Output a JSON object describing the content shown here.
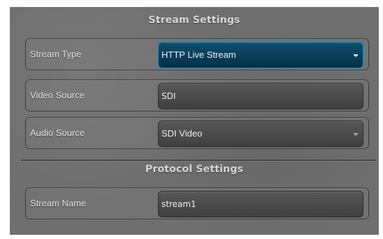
{
  "stream_settings": {
    "title": "Stream Settings",
    "stream_type": {
      "label": "Stream Type",
      "value": "HTTP Live Stream"
    },
    "video_source": {
      "label": "Video Source",
      "value": "SDI"
    },
    "audio_source": {
      "label": "Audio Source",
      "value": "SDI Video"
    }
  },
  "protocol_settings": {
    "title": "Protocol Settings",
    "stream_name": {
      "label": "Stream Name",
      "value": "stream1"
    }
  },
  "colors": {
    "panel_background": "#6f6f6f",
    "active_field": "#0b3f5a",
    "active_border": "#1f80b3"
  },
  "icons": {
    "dropdown": "chevron-down-icon"
  }
}
